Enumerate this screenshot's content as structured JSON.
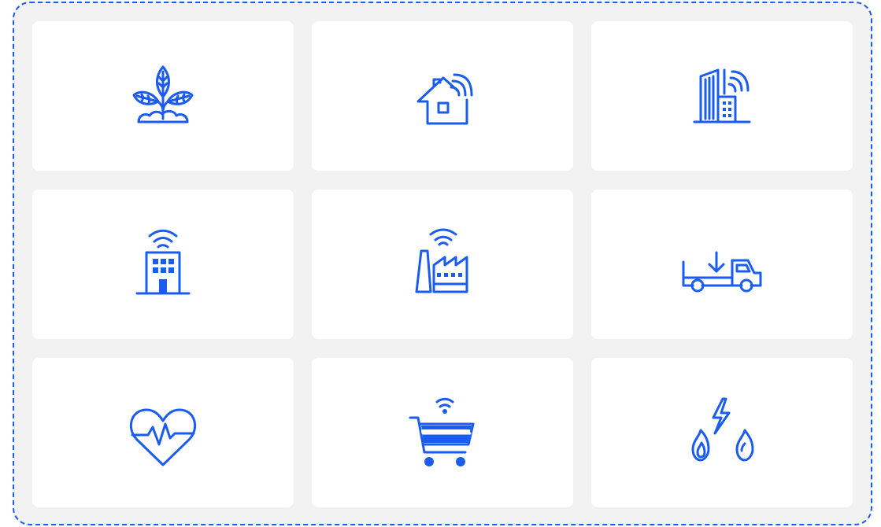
{
  "theme": {
    "accent": "#1a5cf0",
    "tile_background": "#ffffff",
    "panel_background": "#f2f2f2"
  },
  "tiles": [
    {
      "id": "agriculture",
      "icon": "plant-sprout-icon"
    },
    {
      "id": "smart-home",
      "icon": "smart-home-icon"
    },
    {
      "id": "smart-city",
      "icon": "smart-buildings-icon"
    },
    {
      "id": "smart-building",
      "icon": "connected-building-icon"
    },
    {
      "id": "industry",
      "icon": "smart-factory-icon"
    },
    {
      "id": "logistics",
      "icon": "delivery-truck-icon"
    },
    {
      "id": "healthcare",
      "icon": "heart-pulse-icon"
    },
    {
      "id": "retail",
      "icon": "connected-cart-icon"
    },
    {
      "id": "utilities",
      "icon": "energy-gas-water-icon"
    }
  ]
}
